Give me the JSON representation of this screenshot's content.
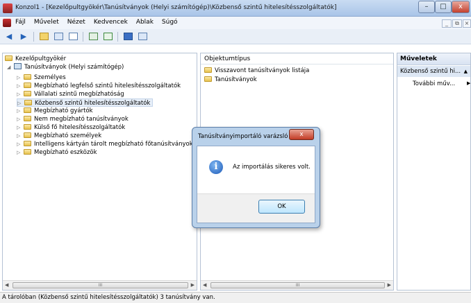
{
  "window": {
    "title": "Konzol1 - [Kezelőpultgyökér\\Tanúsítványok (Helyi számítógép)\\Közbenső szintű hitelesítésszolgáltatók]",
    "minimize": "–",
    "maximize": "□",
    "close": "x"
  },
  "menu": {
    "items": [
      "Fájl",
      "Művelet",
      "Nézet",
      "Kedvencek",
      "Ablak",
      "Súgó"
    ],
    "mdi_minimize": "_",
    "mdi_restore": "⧉",
    "mdi_close": "×"
  },
  "toolbar": {
    "back": "◀",
    "forward": "▶"
  },
  "tree": {
    "root": "Kezelőpultgyökér",
    "certs": "Tanúsítványok (Helyi számítógép)",
    "items": [
      "Személyes",
      "Megbízható legfelső szintű hitelesítésszolgáltatók",
      "Vállalati szintű megbízhatóság",
      "Közbenső szintű hitelesítésszolgáltatók",
      "Megbízható gyártók",
      "Nem megbízható tanúsítványok",
      "Külső fő hitelesítésszolgáltatók",
      "Megbízható személyek",
      "Intelligens kártyán tárolt megbízható főtanúsítványok",
      "Megbízható eszközök"
    ],
    "selected_index": 3
  },
  "list": {
    "header": "Objektumtípus",
    "items": [
      "Visszavont tanúsítványok listája",
      "Tanúsítványok"
    ]
  },
  "actions": {
    "header": "Műveletek",
    "section": "Közbenső szintű hi...",
    "more": "További műv..."
  },
  "scroll": {
    "thumb": "III"
  },
  "status": {
    "text": "A tárolóban (Közbenső szintű hitelesítésszolgáltatók) 3 tanúsítvány van."
  },
  "dialog": {
    "title": "Tanúsítványimportáló varázsló",
    "close": "x",
    "message": "Az importálás sikeres volt.",
    "ok": "OK",
    "icon": "i"
  }
}
